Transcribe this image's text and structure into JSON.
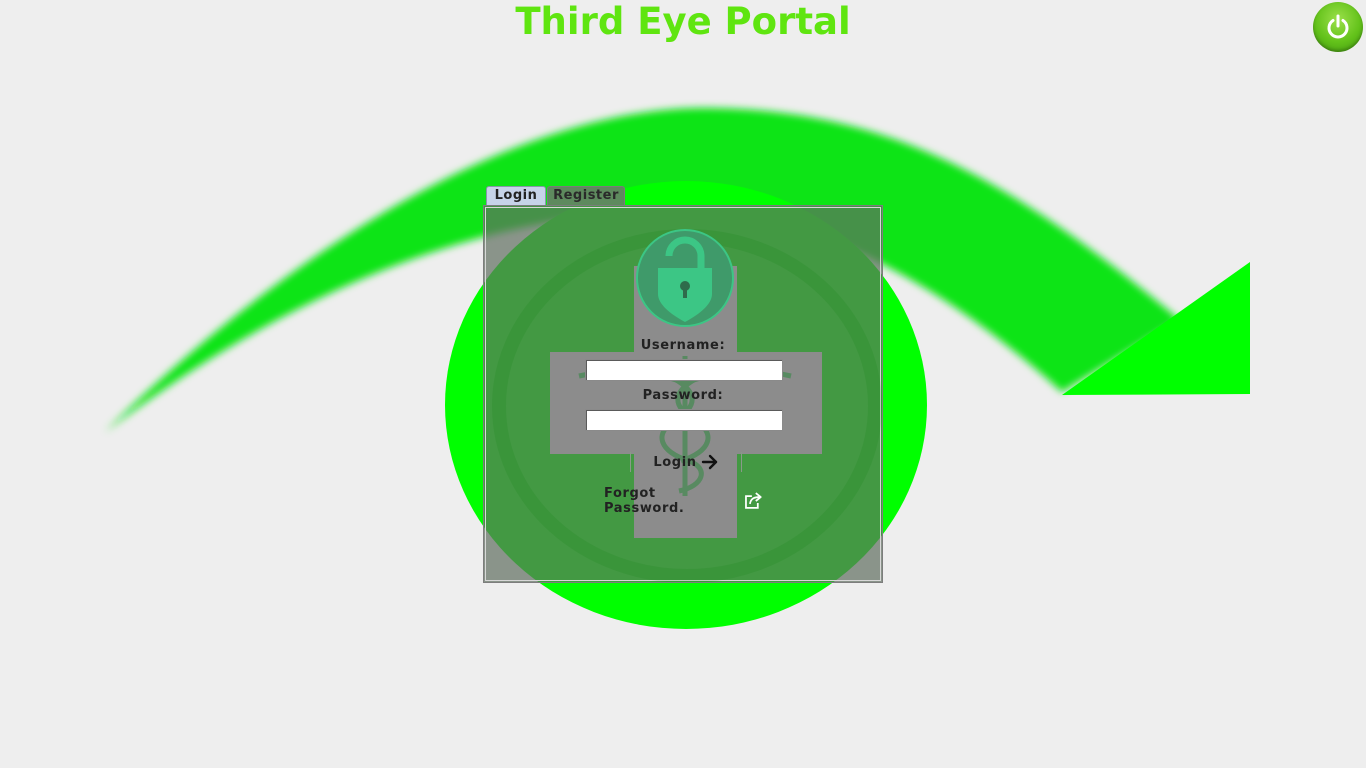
{
  "app": {
    "title": "Third Eye Portal"
  },
  "tabs": [
    {
      "label": "Login",
      "selected": true
    },
    {
      "label": "Register",
      "selected": false
    }
  ],
  "login_form": {
    "username_label": "Username:",
    "username_value": "",
    "password_label": "Password:",
    "password_value": "",
    "login_button_label": "Login",
    "forgot_password_label": "Forgot Password."
  },
  "icons": {
    "power": "power-icon",
    "lock": "lock-icon",
    "login_arrow": "arrow-right-icon",
    "forgot_password": "share-icon",
    "medical_cross": "caduceus-cross-icon"
  },
  "colors": {
    "title": "#5fe510",
    "eye": "#00ff00",
    "power_button": "#63c21a",
    "panel_overlay": "#606e60"
  }
}
